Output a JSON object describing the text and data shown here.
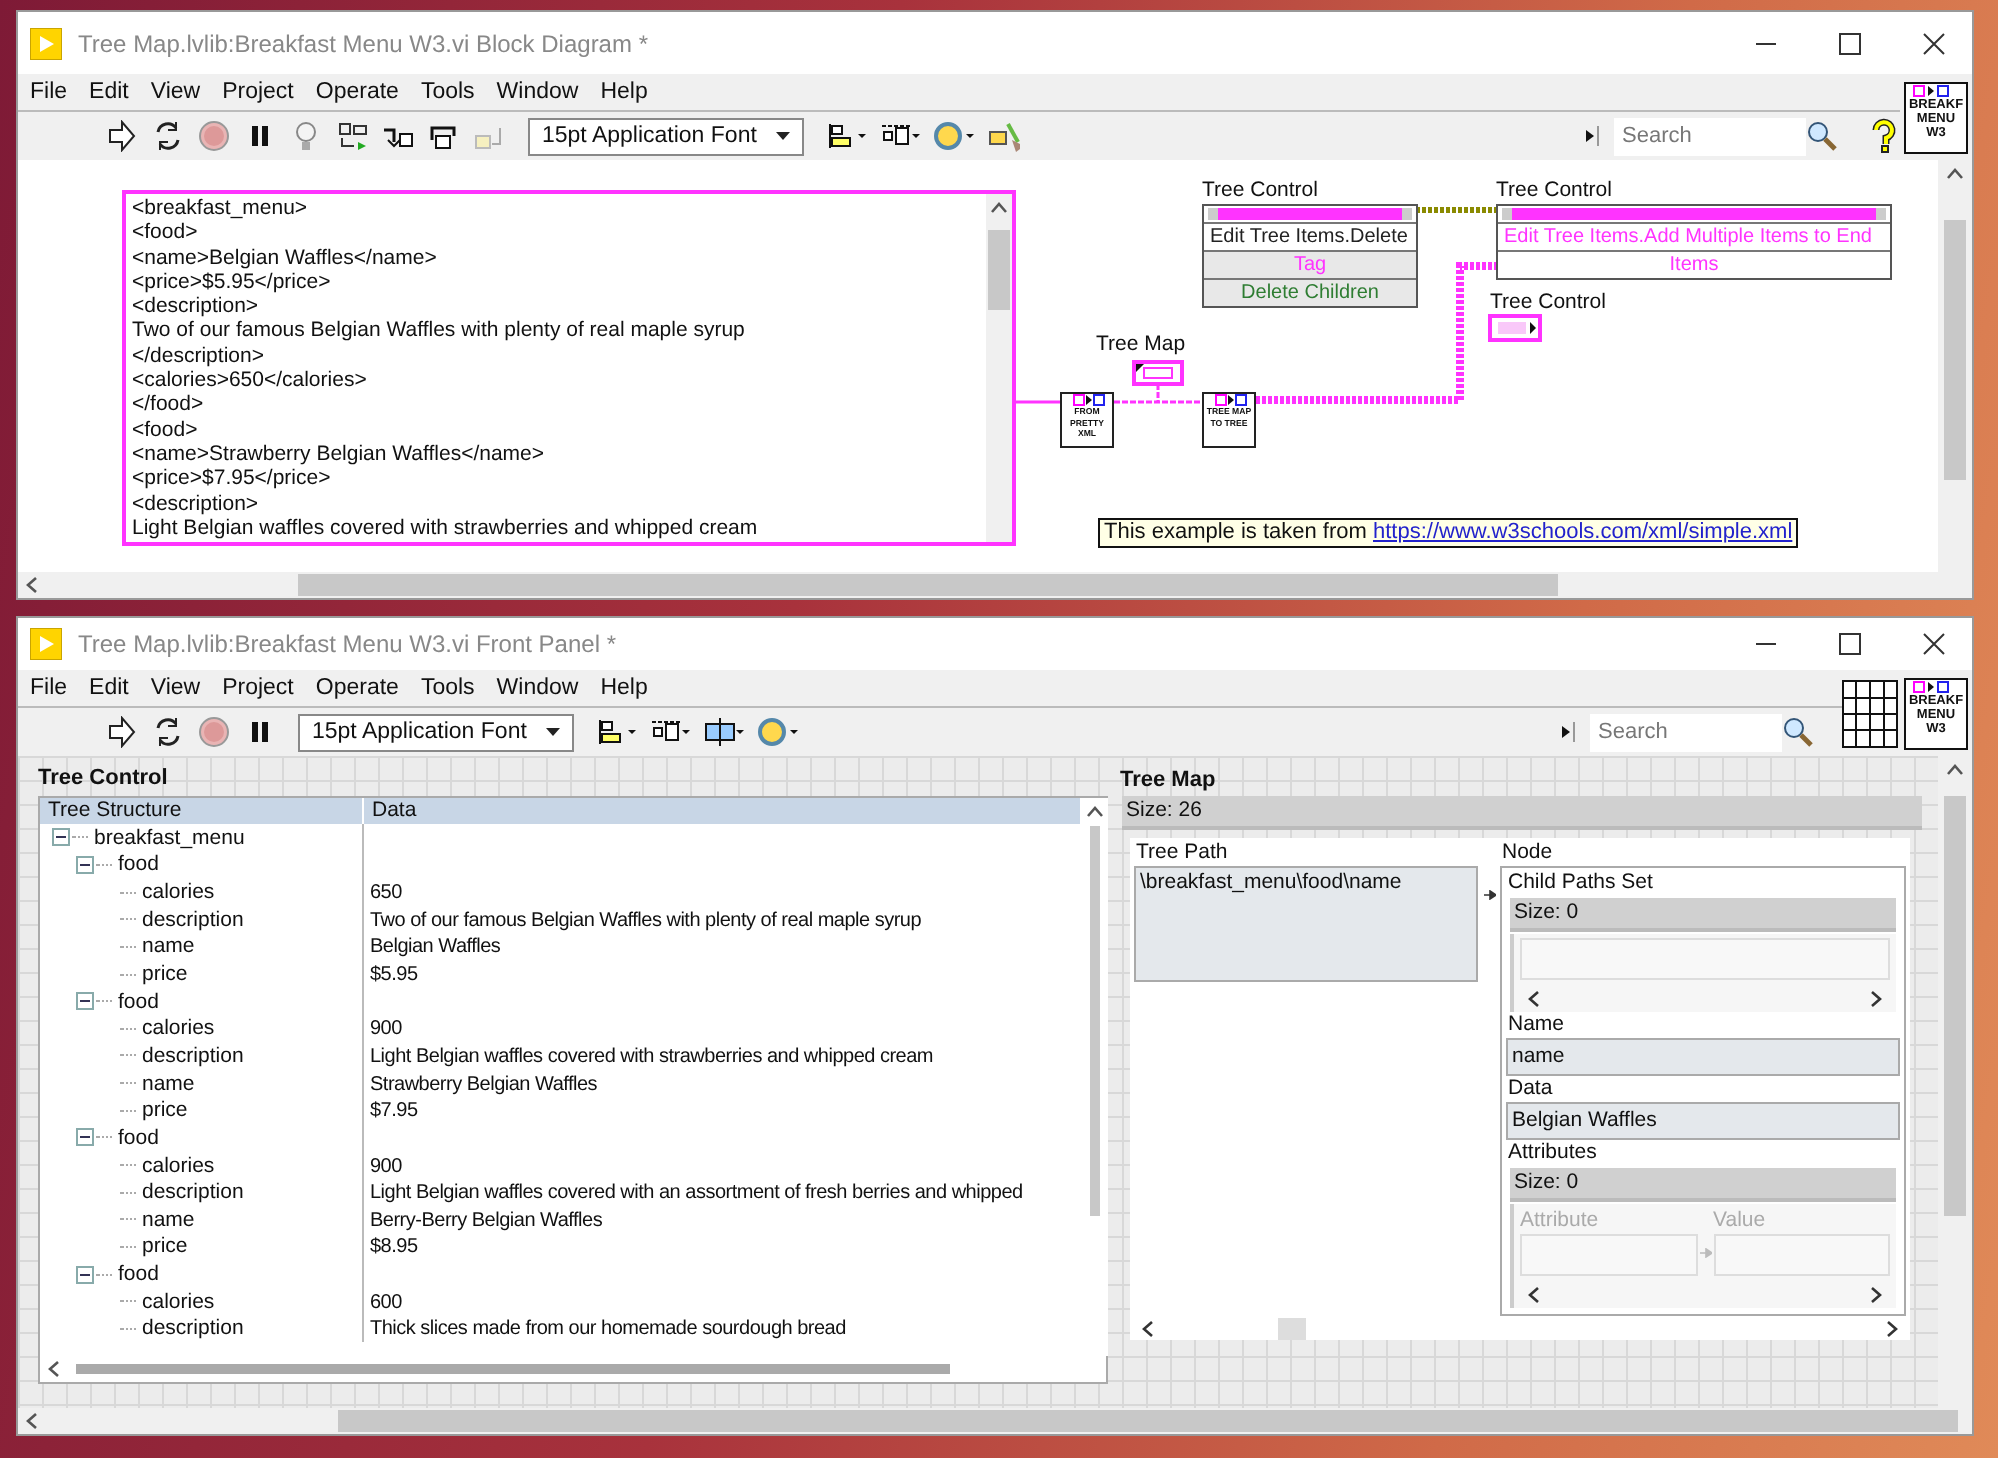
{
  "block_diagram": {
    "title": "Tree Map.lvlib:Breakfast Menu W3.vi Block Diagram *",
    "menu": [
      "File",
      "Edit",
      "View",
      "Project",
      "Operate",
      "Tools",
      "Window",
      "Help"
    ],
    "font": "15pt Application Font",
    "search": {
      "placeholder": "Search"
    },
    "vi_icon": "BREAKF MENU W3",
    "xml_constant": {
      "lines": [
        "<breakfast_menu>",
        "<food>",
        "<name>Belgian Waffles</name>",
        "<price>$5.95</price>",
        "<description>",
        "Two of our famous Belgian Waffles with plenty of real maple syrup",
        "</description>",
        "<calories>650</calories>",
        "</food>",
        "<food>",
        "<name>Strawberry Belgian Waffles</name>",
        "<price>$7.95</price>",
        "<description>",
        "Light Belgian waffles covered with strawberries and whipped cream"
      ]
    },
    "tree_map_terminal": {
      "label": "Tree Map"
    },
    "subvis": [
      {
        "text": "FROM PRETTY XML"
      },
      {
        "text": "TREE MAP TO TREE"
      }
    ],
    "property_nodes": [
      {
        "label": "Tree Control",
        "method": "Edit Tree Items.Delete",
        "color": "#222222",
        "inputs": [
          {
            "name": "Tag",
            "color": "#ff33ff",
            "wired": false
          },
          {
            "name": "Delete Children",
            "color": "#2e7d32",
            "wired": false
          }
        ]
      },
      {
        "label": "Tree Control",
        "method": "Edit Tree Items.Add Multiple Items to End",
        "color": "#ff33ff",
        "inputs": [
          {
            "name": "Items",
            "color": "#ff33ff",
            "wired": true
          }
        ]
      }
    ],
    "tree_terminal": {
      "label": "Tree Control"
    },
    "comment": {
      "text": "This example is taken from",
      "link": "https://www.w3schools.com/xml/simple.xml"
    }
  },
  "front_panel": {
    "title": "Tree Map.lvlib:Breakfast Menu W3.vi Front Panel *",
    "menu": [
      "File",
      "Edit",
      "View",
      "Project",
      "Operate",
      "Tools",
      "Window",
      "Help"
    ],
    "font": "15pt Application Font",
    "search": {
      "placeholder": "Search"
    },
    "vi_icon": "BREAKF MENU W3",
    "tree_control": {
      "label": "Tree Control",
      "columns": [
        "Tree Structure",
        "Data"
      ],
      "rows": [
        {
          "label": "breakfast_menu",
          "expanded": true,
          "children": [
            {
              "label": "food",
              "expanded": true,
              "children": [
                {
                  "label": "calories",
                  "data": "650"
                },
                {
                  "label": "description",
                  "data": "Two of our famous Belgian Waffles with plenty of real maple syrup"
                },
                {
                  "label": "name",
                  "data": "Belgian Waffles"
                },
                {
                  "label": "price",
                  "data": "$5.95"
                }
              ]
            },
            {
              "label": "food",
              "expanded": true,
              "children": [
                {
                  "label": "calories",
                  "data": "900"
                },
                {
                  "label": "description",
                  "data": "Light Belgian waffles covered with strawberries and whipped cream"
                },
                {
                  "label": "name",
                  "data": "Strawberry Belgian Waffles"
                },
                {
                  "label": "price",
                  "data": "$7.95"
                }
              ]
            },
            {
              "label": "food",
              "expanded": true,
              "children": [
                {
                  "label": "calories",
                  "data": "900"
                },
                {
                  "label": "description",
                  "data": "Light Belgian waffles covered with an assortment of fresh berries and whipped"
                },
                {
                  "label": "name",
                  "data": "Berry-Berry Belgian Waffles"
                },
                {
                  "label": "price",
                  "data": "$8.95"
                }
              ]
            },
            {
              "label": "food",
              "expanded": true,
              "children": [
                {
                  "label": "calories",
                  "data": "600"
                },
                {
                  "label": "description",
                  "data": "Thick slices made from our homemade sourdough bread"
                }
              ]
            }
          ]
        }
      ]
    },
    "tree_map": {
      "label": "Tree Map",
      "size": "Size: 26",
      "path_label": "Tree Path",
      "path": "\\breakfast_menu\\food\\name",
      "node_label": "Node",
      "child_paths_label": "Child Paths Set",
      "child_paths_size": "Size: 0",
      "name_label": "Name",
      "name": "name",
      "data_label": "Data",
      "data": "Belgian Waffles",
      "attributes_label": "Attributes",
      "attributes_size": "Size: 0",
      "attribute_column": "Attribute",
      "value_column": "Value"
    }
  }
}
